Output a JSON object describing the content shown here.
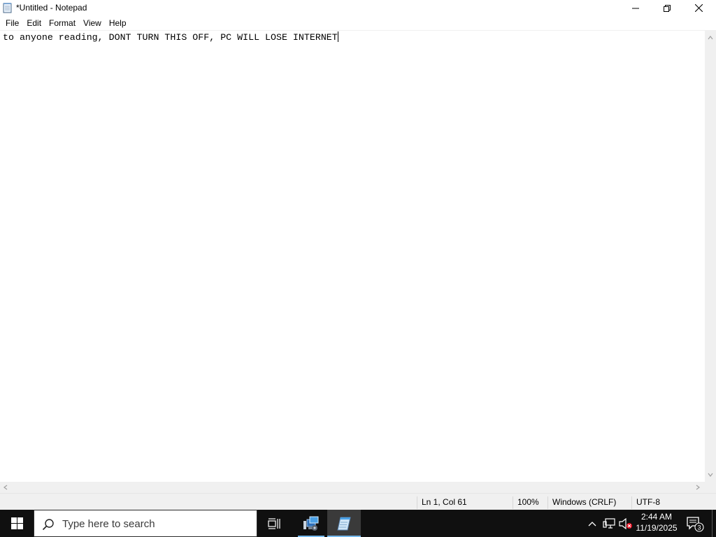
{
  "window": {
    "title": "*Untitled - Notepad",
    "icon": "notepad-icon"
  },
  "menu": {
    "items": [
      "File",
      "Edit",
      "Format",
      "View",
      "Help"
    ]
  },
  "editor": {
    "content": "to anyone reading, DONT TURN THIS OFF, PC WILL LOSE INTERNET"
  },
  "status": {
    "position": "Ln 1, Col 61",
    "zoom": "100%",
    "line_ending": "Windows (CRLF)",
    "encoding": "UTF-8"
  },
  "taskbar": {
    "search_placeholder": "Type here to search",
    "clock_time": "2:44 AM",
    "clock_date": "11/19/2025",
    "notification_count": "3",
    "pinned": [
      "task-view-icon",
      "remote-desktop-icon",
      "notepad-icon"
    ]
  },
  "colors": {
    "taskbar_bg": "#101010",
    "accent": "#76b9ed",
    "statusbar_bg": "#f0f0f0"
  }
}
